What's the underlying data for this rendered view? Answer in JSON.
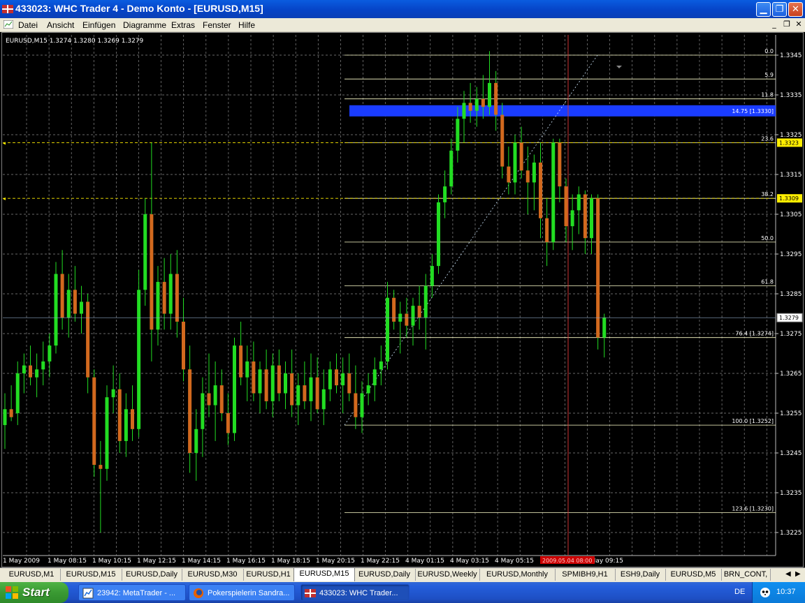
{
  "window": {
    "title": "433023: WHC Trader 4 - Demo Konto - [EURUSD,M15]"
  },
  "menu": [
    "Datei",
    "Ansicht",
    "Einfügen",
    "Diagramme",
    "Extras",
    "Fenster",
    "Hilfe"
  ],
  "chart": {
    "info": "EURUSD,M15  1.3274 1.3280 1.3269 1.3279",
    "price_labels": [
      "1.3345",
      "1.3335",
      "1.3325",
      "1.3315",
      "1.3305",
      "1.3295",
      "1.3285",
      "1.3275",
      "1.3265",
      "1.3255",
      "1.3245",
      "1.3235",
      "1.3225"
    ],
    "current_price": "1.3279",
    "time_labels": [
      "1 May 2009",
      "1 May 08:15",
      "1 May 10:15",
      "1 May 12:15",
      "1 May 14:15",
      "1 May 16:15",
      "1 May 18:15",
      "1 May 20:15",
      "1 May 22:15",
      "4 May 01:15",
      "4 May 03:15",
      "4 May 05:15",
      "4 May 09:15"
    ],
    "crosshair_time": "2009.05.04 08:00",
    "fib_levels": [
      {
        "label": "0.0",
        "price": 1.3345
      },
      {
        "label": "5.9",
        "price": 1.3339
      },
      {
        "label": "11.8",
        "price": 1.3334
      },
      {
        "label": "23.6",
        "price": 1.3323
      },
      {
        "label": "38.2",
        "price": 1.3309
      },
      {
        "label": "50.0",
        "price": 1.3298
      },
      {
        "label": "61.8",
        "price": 1.3287
      },
      {
        "label": "76.4 [1.3274]",
        "price": 1.3274
      },
      {
        "label": "100.0 [1.3252]",
        "price": 1.3252
      },
      {
        "label": "123.6 [1.3230]",
        "price": 1.323
      }
    ],
    "fib_highlight": {
      "label": "14.75 [1.3330]",
      "price": 1.3331
    },
    "yellow_tags": [
      "1.3323",
      "1.3309"
    ],
    "colors": {
      "bull": "#22dd22",
      "bear": "#d2691e",
      "fib": "#ffffcc",
      "grid": "#8a8a8a",
      "highlight": "#1a3cff",
      "crosshair": "#cc3333"
    }
  },
  "tabs": [
    "EURUSD,M1",
    "EURUSD,M15",
    "EURUSD,Daily",
    "EURUSD,M30",
    "EURUSD,H1",
    "EURUSD,M15",
    "EURUSD,Daily",
    "EURUSD,Weekly",
    "EURUSD,Monthly",
    "SPMIBH9,H1",
    "ESH9,Daily",
    "EURUSD,M5",
    "BRN_CONT,"
  ],
  "taskbar": {
    "start": "Start",
    "items": [
      "23942: MetaTrader - ...",
      "Pokerspielerin Sandra...",
      "433023: WHC Trader..."
    ],
    "lang": "DE",
    "clock": "10:37"
  },
  "chart_data": {
    "type": "candlestick",
    "symbol": "EURUSD",
    "timeframe": "M15",
    "ylim": [
      1.3221,
      1.335
    ],
    "open": 1.3274,
    "high": 1.328,
    "low": 1.3269,
    "close": 1.3279,
    "candles": [
      [
        1.3252,
        1.326,
        1.3246,
        1.3256
      ],
      [
        1.3256,
        1.3262,
        1.3253,
        1.3254
      ],
      [
        1.3255,
        1.3268,
        1.3252,
        1.3265
      ],
      [
        1.3265,
        1.327,
        1.326,
        1.3267
      ],
      [
        1.3267,
        1.3272,
        1.3262,
        1.3264
      ],
      [
        1.3264,
        1.327,
        1.3259,
        1.3266
      ],
      [
        1.3266,
        1.3273,
        1.3262,
        1.3268
      ],
      [
        1.3268,
        1.3275,
        1.3264,
        1.3272
      ],
      [
        1.3272,
        1.3293,
        1.327,
        1.329
      ],
      [
        1.329,
        1.3296,
        1.3276,
        1.3279
      ],
      [
        1.3279,
        1.329,
        1.3274,
        1.3286
      ],
      [
        1.3286,
        1.3292,
        1.3278,
        1.328
      ],
      [
        1.328,
        1.3287,
        1.3275,
        1.3283
      ],
      [
        1.3283,
        1.3285,
        1.326,
        1.3264
      ],
      [
        1.3264,
        1.3266,
        1.3239,
        1.3242
      ],
      [
        1.3242,
        1.3248,
        1.3225,
        1.3241
      ],
      [
        1.3241,
        1.3262,
        1.3238,
        1.3259
      ],
      [
        1.3259,
        1.3267,
        1.3255,
        1.3261
      ],
      [
        1.3261,
        1.3265,
        1.3245,
        1.3248
      ],
      [
        1.3248,
        1.326,
        1.3244,
        1.3256
      ],
      [
        1.3256,
        1.3262,
        1.3248,
        1.3251
      ],
      [
        1.3251,
        1.3291,
        1.3249,
        1.3286
      ],
      [
        1.3286,
        1.3309,
        1.3282,
        1.3305
      ],
      [
        1.3305,
        1.3323,
        1.3268,
        1.3276
      ],
      [
        1.3276,
        1.3292,
        1.3272,
        1.3288
      ],
      [
        1.3288,
        1.3294,
        1.3276,
        1.328
      ],
      [
        1.328,
        1.3295,
        1.3276,
        1.329
      ],
      [
        1.329,
        1.3296,
        1.3274,
        1.3278
      ],
      [
        1.3278,
        1.3284,
        1.3263,
        1.3266
      ],
      [
        1.3266,
        1.3272,
        1.324,
        1.3245
      ],
      [
        1.3245,
        1.3256,
        1.3238,
        1.3251
      ],
      [
        1.3251,
        1.3264,
        1.3244,
        1.326
      ],
      [
        1.326,
        1.327,
        1.3254,
        1.3257
      ],
      [
        1.3257,
        1.3268,
        1.3248,
        1.3262
      ],
      [
        1.3262,
        1.3266,
        1.3253,
        1.3255
      ],
      [
        1.3255,
        1.326,
        1.3247,
        1.325
      ],
      [
        1.325,
        1.3274,
        1.3248,
        1.3272
      ],
      [
        1.3272,
        1.3278,
        1.3262,
        1.3264
      ],
      [
        1.3264,
        1.3272,
        1.3258,
        1.3268
      ],
      [
        1.3268,
        1.3273,
        1.3258,
        1.326
      ],
      [
        1.326,
        1.3268,
        1.3255,
        1.3266
      ],
      [
        1.3266,
        1.3271,
        1.3256,
        1.3258
      ],
      [
        1.3258,
        1.327,
        1.3254,
        1.3267
      ],
      [
        1.3267,
        1.3271,
        1.3258,
        1.326
      ],
      [
        1.326,
        1.3268,
        1.3256,
        1.3265
      ],
      [
        1.3265,
        1.3271,
        1.3254,
        1.3257
      ],
      [
        1.3257,
        1.3265,
        1.3252,
        1.3262
      ],
      [
        1.3262,
        1.3268,
        1.3256,
        1.3258
      ],
      [
        1.3258,
        1.327,
        1.3253,
        1.3264
      ],
      [
        1.3264,
        1.3269,
        1.3255,
        1.3256
      ],
      [
        1.3256,
        1.3266,
        1.3252,
        1.3261
      ],
      [
        1.3261,
        1.3268,
        1.3258,
        1.3266
      ],
      [
        1.3266,
        1.327,
        1.326,
        1.3262
      ],
      [
        1.3262,
        1.3269,
        1.3255,
        1.3265
      ],
      [
        1.3265,
        1.327,
        1.3258,
        1.326
      ],
      [
        1.326,
        1.3267,
        1.3251,
        1.3254
      ],
      [
        1.3254,
        1.3263,
        1.325,
        1.326
      ],
      [
        1.326,
        1.3265,
        1.3257,
        1.3262
      ],
      [
        1.3262,
        1.3269,
        1.3258,
        1.3266
      ],
      [
        1.3266,
        1.3272,
        1.3262,
        1.3268
      ],
      [
        1.3268,
        1.3288,
        1.3266,
        1.3284
      ],
      [
        1.3284,
        1.3286,
        1.3276,
        1.3278
      ],
      [
        1.3278,
        1.3283,
        1.327,
        1.328
      ],
      [
        1.328,
        1.3284,
        1.3274,
        1.3277
      ],
      [
        1.3277,
        1.3284,
        1.3272,
        1.3282
      ],
      [
        1.3282,
        1.3287,
        1.3276,
        1.3279
      ],
      [
        1.3279,
        1.329,
        1.3271,
        1.3287
      ],
      [
        1.3287,
        1.3295,
        1.3284,
        1.3292
      ],
      [
        1.3292,
        1.331,
        1.329,
        1.3308
      ],
      [
        1.3308,
        1.3316,
        1.3304,
        1.3312
      ],
      [
        1.3312,
        1.3324,
        1.331,
        1.3321
      ],
      [
        1.3321,
        1.3332,
        1.3318,
        1.3329
      ],
      [
        1.3329,
        1.3336,
        1.3323,
        1.3333
      ],
      [
        1.3333,
        1.3338,
        1.3328,
        1.3331
      ],
      [
        1.3331,
        1.3337,
        1.3327,
        1.3334
      ],
      [
        1.3334,
        1.334,
        1.3329,
        1.3332
      ],
      [
        1.3332,
        1.3346,
        1.333,
        1.3338
      ],
      [
        1.3338,
        1.3341,
        1.3326,
        1.333
      ],
      [
        1.333,
        1.3333,
        1.3314,
        1.3317
      ],
      [
        1.3317,
        1.3322,
        1.331,
        1.3313
      ],
      [
        1.3313,
        1.3325,
        1.331,
        1.3323
      ],
      [
        1.3323,
        1.3327,
        1.3314,
        1.3316
      ],
      [
        1.3316,
        1.3322,
        1.3305,
        1.3313
      ],
      [
        1.3313,
        1.332,
        1.3306,
        1.3318
      ],
      [
        1.3318,
        1.3323,
        1.3299,
        1.3304
      ],
      [
        1.3304,
        1.3309,
        1.3292,
        1.3298
      ],
      [
        1.3298,
        1.3324,
        1.3296,
        1.3323
      ],
      [
        1.3323,
        1.3324,
        1.3308,
        1.3312
      ],
      [
        1.3312,
        1.3314,
        1.3298,
        1.3302
      ],
      [
        1.3302,
        1.331,
        1.3296,
        1.3306
      ],
      [
        1.3306,
        1.3312,
        1.33,
        1.331
      ],
      [
        1.331,
        1.3311,
        1.3295,
        1.3299
      ],
      [
        1.3299,
        1.331,
        1.3295,
        1.3309
      ],
      [
        1.3309,
        1.331,
        1.3271,
        1.3274
      ],
      [
        1.3274,
        1.328,
        1.3269,
        1.3279
      ]
    ]
  }
}
